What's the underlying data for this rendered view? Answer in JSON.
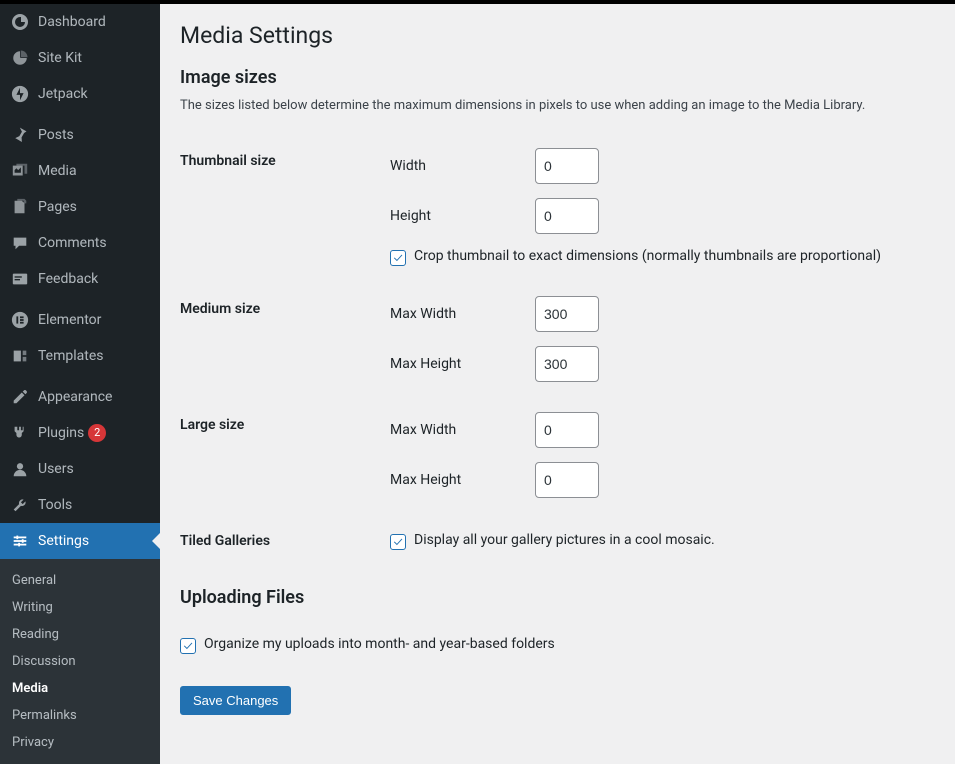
{
  "sidebar": {
    "items": [
      {
        "label": "Dashboard"
      },
      {
        "label": "Site Kit"
      },
      {
        "label": "Jetpack"
      },
      {
        "label": "Posts"
      },
      {
        "label": "Media"
      },
      {
        "label": "Pages"
      },
      {
        "label": "Comments"
      },
      {
        "label": "Feedback"
      },
      {
        "label": "Elementor"
      },
      {
        "label": "Templates"
      },
      {
        "label": "Appearance"
      },
      {
        "label": "Plugins",
        "badge": "2"
      },
      {
        "label": "Users"
      },
      {
        "label": "Tools"
      },
      {
        "label": "Settings"
      }
    ],
    "submenu": [
      {
        "label": "General"
      },
      {
        "label": "Writing"
      },
      {
        "label": "Reading"
      },
      {
        "label": "Discussion"
      },
      {
        "label": "Media"
      },
      {
        "label": "Permalinks"
      },
      {
        "label": "Privacy"
      }
    ]
  },
  "page": {
    "title": "Media Settings",
    "section_image_sizes": "Image sizes",
    "desc_image_sizes": "The sizes listed below determine the maximum dimensions in pixels to use when adding an image to the Media Library.",
    "thumbnail": {
      "heading": "Thumbnail size",
      "width_label": "Width",
      "width_value": "0",
      "height_label": "Height",
      "height_value": "0",
      "crop_label": "Crop thumbnail to exact dimensions (normally thumbnails are proportional)"
    },
    "medium": {
      "heading": "Medium size",
      "width_label": "Max Width",
      "width_value": "300",
      "height_label": "Max Height",
      "height_value": "300"
    },
    "large": {
      "heading": "Large size",
      "width_label": "Max Width",
      "width_value": "0",
      "height_label": "Max Height",
      "height_value": "0"
    },
    "tiled": {
      "heading": "Tiled Galleries",
      "label": "Display all your gallery pictures in a cool mosaic."
    },
    "section_uploading": "Uploading Files",
    "organize_label": "Organize my uploads into month- and year-based folders",
    "save_button": "Save Changes"
  }
}
